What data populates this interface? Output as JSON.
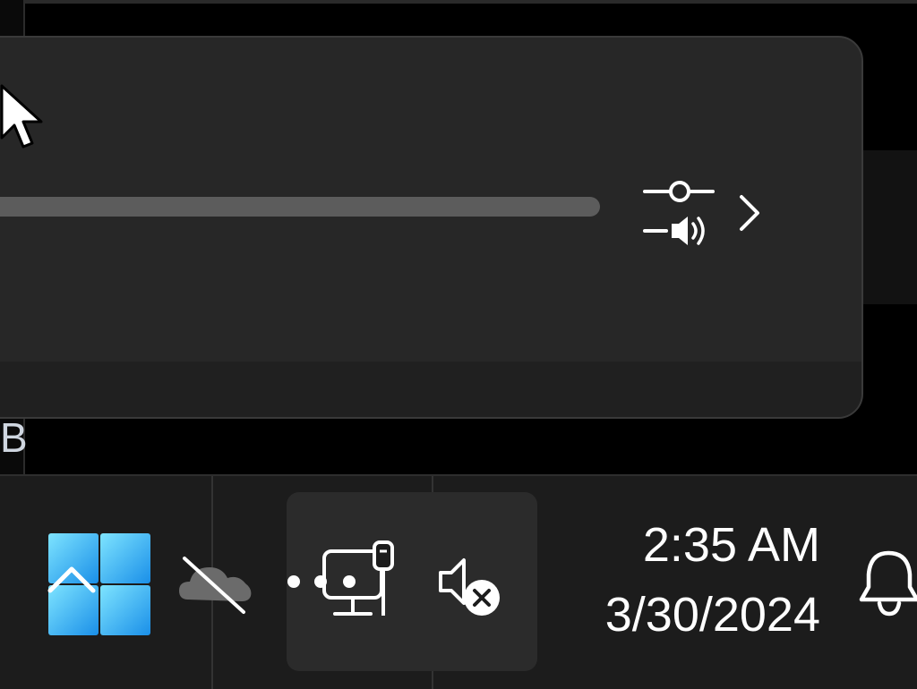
{
  "background": {
    "partial_letter": "B"
  },
  "flyout": {
    "volume_level_percent": 0,
    "mixer_icon": "volume-mixer-icon",
    "expand_icon": "chevron-right-icon"
  },
  "taskbar": {
    "start_icon": "windows-logo-icon",
    "overflow_icon": "chevron-up-icon",
    "onedrive_icon": "onedrive-offline-icon",
    "network_icon": "ethernet-network-icon",
    "volume_icon": "speaker-muted-icon",
    "clock": {
      "time": "2:35 AM",
      "date": "3/30/2024"
    },
    "notification_icon": "bell-icon"
  },
  "colors": {
    "taskbar_bg": "#1c1c1c",
    "flyout_bg": "#272727",
    "slider_track": "#5c5c5c",
    "text": "#ffffff",
    "win_logo_start": "#7ee4ff",
    "win_logo_end": "#1a8fe8"
  }
}
